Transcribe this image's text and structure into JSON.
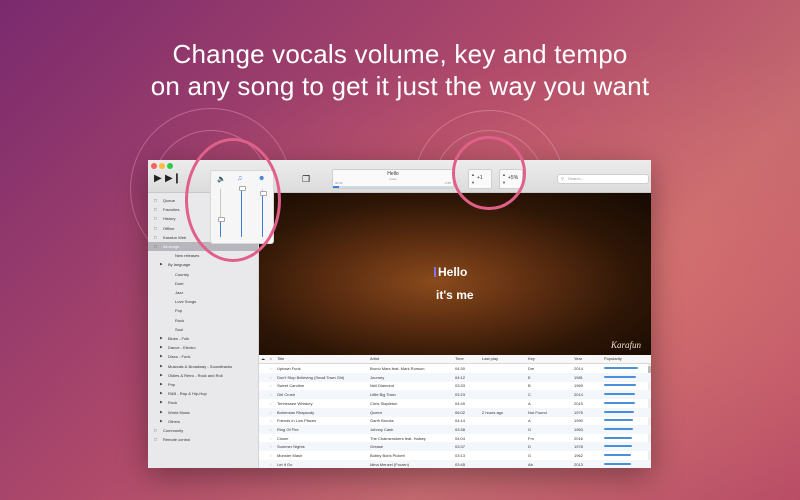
{
  "headline": {
    "line1": "Change vocals volume, key and tempo",
    "line2": "on any song to get it just the way you want"
  },
  "colors": {
    "accent": "#3d7dd8",
    "highlight_ring": "#e0608a",
    "popularity": "#4a90d9"
  },
  "toolbar": {
    "play_icon": "play-icon",
    "next_icon": "skip-next-icon",
    "screen_icon": "screen-icon",
    "now_playing": {
      "title": "Hello",
      "subtitle": "Adele",
      "elapsed": "00:00",
      "remaining": "-4:55",
      "progress": 0.05
    },
    "key_value": "+1",
    "tempo_value": "+5%",
    "search_placeholder": "Search..."
  },
  "mixer": {
    "icons": [
      "speaker-icon",
      "audience-icon",
      "singer-icon"
    ],
    "levels": [
      0.35,
      1.0,
      0.9
    ]
  },
  "sidebar": {
    "items": [
      {
        "label": "Queue",
        "icon": "queue-icon",
        "indent": 0
      },
      {
        "label": "Favorites",
        "icon": "star-icon",
        "indent": 0
      },
      {
        "label": "History",
        "icon": "clock-icon",
        "indent": 0
      },
      {
        "label": "Offline",
        "icon": "cloud-icon",
        "indent": 0
      },
      {
        "label": "Karafun Web",
        "icon": "globe-icon",
        "indent": 0
      },
      {
        "label": "All songs",
        "icon": "note-icon",
        "indent": 0,
        "selected": true
      },
      {
        "label": "New releases",
        "indent": 2
      },
      {
        "label": "By language",
        "indent": 1,
        "expandable": true
      },
      {
        "label": "Country",
        "indent": 2
      },
      {
        "label": "Duet",
        "indent": 2
      },
      {
        "label": "Jazz",
        "indent": 2
      },
      {
        "label": "Love Songs",
        "indent": 2
      },
      {
        "label": "Pop",
        "indent": 2
      },
      {
        "label": "Rock",
        "indent": 2
      },
      {
        "label": "Soul",
        "indent": 2
      },
      {
        "label": "Blues - Folk",
        "indent": 1,
        "expandable": true
      },
      {
        "label": "Dance - Electro",
        "indent": 1,
        "expandable": true
      },
      {
        "label": "Disco - Funk",
        "indent": 1,
        "expandable": true
      },
      {
        "label": "Musicals & Broadway - Soundtracks",
        "indent": 1,
        "expandable": true
      },
      {
        "label": "Oldies & Retro - Rock and Roll",
        "indent": 1,
        "expandable": true
      },
      {
        "label": "Pop",
        "indent": 1,
        "expandable": true
      },
      {
        "label": "R&B - Rap & Hip-Hop",
        "indent": 1,
        "expandable": true
      },
      {
        "label": "Rock",
        "indent": 1,
        "expandable": true
      },
      {
        "label": "World Music",
        "indent": 1,
        "expandable": true
      },
      {
        "label": "Others",
        "indent": 1,
        "expandable": true
      },
      {
        "label": "Community",
        "icon": "community-icon",
        "indent": 0
      },
      {
        "label": "Remote control",
        "icon": "remote-icon",
        "indent": 0
      }
    ]
  },
  "video": {
    "lyric_line1": "Hello",
    "lyric_line2": "it's me",
    "brand": "Karafun"
  },
  "table": {
    "columns": [
      "Title",
      "Artist",
      "Time",
      "Last play",
      "Key",
      "Year",
      "Popularity"
    ],
    "rows": [
      {
        "title": "Uptown Funk",
        "artist": "Bruno Mars feat. Mark Ronson",
        "time": "04:30",
        "last": "",
        "key": "Dm",
        "year": "2014",
        "pop": 0.95
      },
      {
        "title": "Don't Stop Believing (Small Town Girl)",
        "artist": "Journey",
        "time": "04:12",
        "last": "",
        "key": "E",
        "year": "1981",
        "pop": 0.9
      },
      {
        "title": "Sweet Caroline",
        "artist": "Neil Diamond",
        "time": "03:33",
        "last": "",
        "key": "B",
        "year": "1969",
        "pop": 0.88
      },
      {
        "title": "Girl Crush",
        "artist": "Little Big Town",
        "time": "03:23",
        "last": "",
        "key": "C",
        "year": "2014",
        "pop": 0.85
      },
      {
        "title": "Tennessee Whiskey",
        "artist": "Chris Stapleton",
        "time": "04:49",
        "last": "",
        "key": "A",
        "year": "2015",
        "pop": 0.85
      },
      {
        "title": "Bohemian Rhapsody",
        "artist": "Queen",
        "time": "06:02",
        "last": "2 hours ago",
        "key": "Not Found",
        "year": "1975",
        "pop": 0.82
      },
      {
        "title": "Friends in Low Places",
        "artist": "Garth Brooks",
        "time": "04:14",
        "last": "",
        "key": "A",
        "year": "1990",
        "pop": 0.8
      },
      {
        "title": "Ring Of Fire",
        "artist": "Johnny Cash",
        "time": "03:38",
        "last": "",
        "key": "G",
        "year": "1963",
        "pop": 0.8
      },
      {
        "title": "Closer",
        "artist": "The Chainsmokers feat. Halsey",
        "time": "04:04",
        "last": "",
        "key": "Fm",
        "year": "2016",
        "pop": 0.78
      },
      {
        "title": "Summer Nights",
        "artist": "Grease",
        "time": "03:37",
        "last": "",
        "key": "D",
        "year": "1978",
        "pop": 0.78
      },
      {
        "title": "Monster Mash",
        "artist": "Bobby Boris Pickett",
        "time": "03:13",
        "last": "",
        "key": "G",
        "year": "1962",
        "pop": 0.75
      },
      {
        "title": "Let It Go",
        "artist": "Idina Menzel (Frozen)",
        "time": "03:45",
        "last": "",
        "key": "Ab",
        "year": "2013",
        "pop": 0.75
      }
    ]
  }
}
